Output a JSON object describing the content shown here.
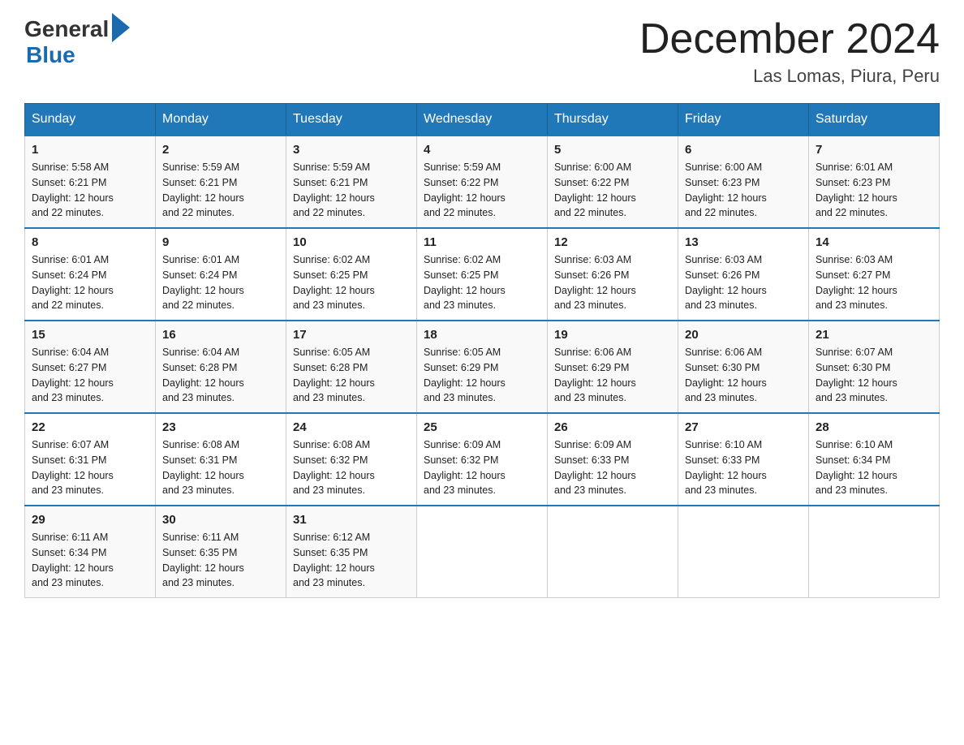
{
  "header": {
    "logo_general": "General",
    "logo_blue": "Blue",
    "title": "December 2024",
    "subtitle": "Las Lomas, Piura, Peru"
  },
  "days_of_week": [
    "Sunday",
    "Monday",
    "Tuesday",
    "Wednesday",
    "Thursday",
    "Friday",
    "Saturday"
  ],
  "weeks": [
    [
      {
        "day": "1",
        "sunrise": "5:58 AM",
        "sunset": "6:21 PM",
        "daylight": "12 hours and 22 minutes."
      },
      {
        "day": "2",
        "sunrise": "5:59 AM",
        "sunset": "6:21 PM",
        "daylight": "12 hours and 22 minutes."
      },
      {
        "day": "3",
        "sunrise": "5:59 AM",
        "sunset": "6:21 PM",
        "daylight": "12 hours and 22 minutes."
      },
      {
        "day": "4",
        "sunrise": "5:59 AM",
        "sunset": "6:22 PM",
        "daylight": "12 hours and 22 minutes."
      },
      {
        "day": "5",
        "sunrise": "6:00 AM",
        "sunset": "6:22 PM",
        "daylight": "12 hours and 22 minutes."
      },
      {
        "day": "6",
        "sunrise": "6:00 AM",
        "sunset": "6:23 PM",
        "daylight": "12 hours and 22 minutes."
      },
      {
        "day": "7",
        "sunrise": "6:01 AM",
        "sunset": "6:23 PM",
        "daylight": "12 hours and 22 minutes."
      }
    ],
    [
      {
        "day": "8",
        "sunrise": "6:01 AM",
        "sunset": "6:24 PM",
        "daylight": "12 hours and 22 minutes."
      },
      {
        "day": "9",
        "sunrise": "6:01 AM",
        "sunset": "6:24 PM",
        "daylight": "12 hours and 22 minutes."
      },
      {
        "day": "10",
        "sunrise": "6:02 AM",
        "sunset": "6:25 PM",
        "daylight": "12 hours and 23 minutes."
      },
      {
        "day": "11",
        "sunrise": "6:02 AM",
        "sunset": "6:25 PM",
        "daylight": "12 hours and 23 minutes."
      },
      {
        "day": "12",
        "sunrise": "6:03 AM",
        "sunset": "6:26 PM",
        "daylight": "12 hours and 23 minutes."
      },
      {
        "day": "13",
        "sunrise": "6:03 AM",
        "sunset": "6:26 PM",
        "daylight": "12 hours and 23 minutes."
      },
      {
        "day": "14",
        "sunrise": "6:03 AM",
        "sunset": "6:27 PM",
        "daylight": "12 hours and 23 minutes."
      }
    ],
    [
      {
        "day": "15",
        "sunrise": "6:04 AM",
        "sunset": "6:27 PM",
        "daylight": "12 hours and 23 minutes."
      },
      {
        "day": "16",
        "sunrise": "6:04 AM",
        "sunset": "6:28 PM",
        "daylight": "12 hours and 23 minutes."
      },
      {
        "day": "17",
        "sunrise": "6:05 AM",
        "sunset": "6:28 PM",
        "daylight": "12 hours and 23 minutes."
      },
      {
        "day": "18",
        "sunrise": "6:05 AM",
        "sunset": "6:29 PM",
        "daylight": "12 hours and 23 minutes."
      },
      {
        "day": "19",
        "sunrise": "6:06 AM",
        "sunset": "6:29 PM",
        "daylight": "12 hours and 23 minutes."
      },
      {
        "day": "20",
        "sunrise": "6:06 AM",
        "sunset": "6:30 PM",
        "daylight": "12 hours and 23 minutes."
      },
      {
        "day": "21",
        "sunrise": "6:07 AM",
        "sunset": "6:30 PM",
        "daylight": "12 hours and 23 minutes."
      }
    ],
    [
      {
        "day": "22",
        "sunrise": "6:07 AM",
        "sunset": "6:31 PM",
        "daylight": "12 hours and 23 minutes."
      },
      {
        "day": "23",
        "sunrise": "6:08 AM",
        "sunset": "6:31 PM",
        "daylight": "12 hours and 23 minutes."
      },
      {
        "day": "24",
        "sunrise": "6:08 AM",
        "sunset": "6:32 PM",
        "daylight": "12 hours and 23 minutes."
      },
      {
        "day": "25",
        "sunrise": "6:09 AM",
        "sunset": "6:32 PM",
        "daylight": "12 hours and 23 minutes."
      },
      {
        "day": "26",
        "sunrise": "6:09 AM",
        "sunset": "6:33 PM",
        "daylight": "12 hours and 23 minutes."
      },
      {
        "day": "27",
        "sunrise": "6:10 AM",
        "sunset": "6:33 PM",
        "daylight": "12 hours and 23 minutes."
      },
      {
        "day": "28",
        "sunrise": "6:10 AM",
        "sunset": "6:34 PM",
        "daylight": "12 hours and 23 minutes."
      }
    ],
    [
      {
        "day": "29",
        "sunrise": "6:11 AM",
        "sunset": "6:34 PM",
        "daylight": "12 hours and 23 minutes."
      },
      {
        "day": "30",
        "sunrise": "6:11 AM",
        "sunset": "6:35 PM",
        "daylight": "12 hours and 23 minutes."
      },
      {
        "day": "31",
        "sunrise": "6:12 AM",
        "sunset": "6:35 PM",
        "daylight": "12 hours and 23 minutes."
      },
      null,
      null,
      null,
      null
    ]
  ],
  "labels": {
    "sunrise": "Sunrise: ",
    "sunset": "Sunset: ",
    "daylight": "Daylight: "
  }
}
